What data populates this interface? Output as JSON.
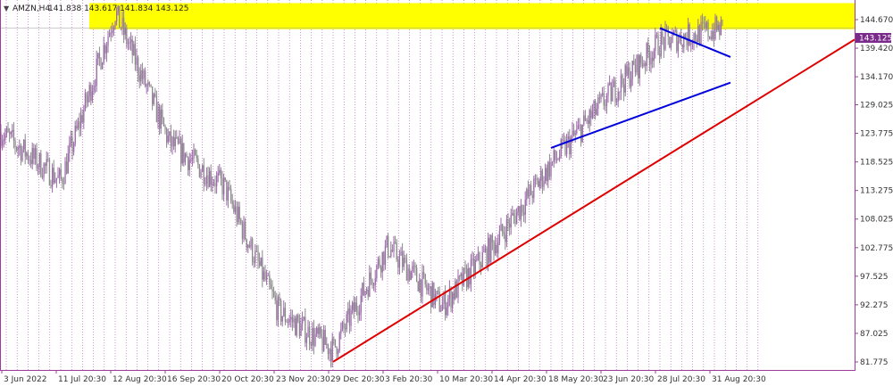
{
  "header": {
    "symbol": "AMZN,H4",
    "ohlc": "141.838 143.617 141.834 143.125"
  },
  "current_price": {
    "label": "143.125",
    "value": 143.125
  },
  "colors": {
    "candle_up": "#9b6aa8",
    "candle_down": "#8a8a8a",
    "grid": "#b04fb0",
    "axis": "#9c3d9c",
    "zone": "#ffff00",
    "support": "#e00000",
    "triangle": "#0000dd",
    "price_box": "#7a2a8a"
  },
  "chart_data": {
    "type": "candlestick",
    "title": "",
    "xlabel": "",
    "ylabel": "",
    "ylim": [
      80.0,
      149.0
    ],
    "y_ticks": [
      "144.670",
      "139.420",
      "134.170",
      "129.025",
      "123.775",
      "118.525",
      "113.275",
      "108.025",
      "102.775",
      "97.525",
      "92.275",
      "87.025",
      "81.775"
    ],
    "y_tick_values": [
      144.67,
      139.42,
      134.17,
      129.025,
      123.775,
      118.525,
      113.275,
      108.025,
      102.775,
      97.525,
      92.275,
      87.025,
      81.775
    ],
    "x_labels": [
      "3 Jun 2022",
      "11 Jul 20:30",
      "12 Aug 20:30",
      "16 Sep 20:30",
      "20 Oct 20:30",
      "23 Nov 20:30",
      "29 Dec 20:30",
      "3 Feb 20:30",
      "10 Mar 20:30",
      "14 Apr 20:30",
      "18 May 20:30",
      "23 Jun 20:30",
      "28 Jul 20:30",
      "31 Aug 20:30"
    ],
    "price_path": [
      [
        "3 Jun 2022",
        124.0
      ],
      [
        "11 Jul 20:30",
        115.0
      ],
      [
        "12 Aug 20:30",
        146.0
      ],
      [
        "16 Sep 20:30",
        122.0
      ],
      [
        "20 Oct 20:30",
        114.0
      ],
      [
        "23 Nov 20:30",
        91.0
      ],
      [
        "29 Dec 20:30",
        84.0
      ],
      [
        "3 Feb 20:30",
        103.0
      ],
      [
        "10 Mar 20:30",
        92.0
      ],
      [
        "14 Apr 20:30",
        104.0
      ],
      [
        "18 May 20:30",
        118.0
      ],
      [
        "23 Jun 20:30",
        130.0
      ],
      [
        "28 Jul 20:30",
        140.5
      ],
      [
        "31 Aug 20:30",
        143.125
      ]
    ],
    "resistance_zone": [
      142.9,
      147.7
    ],
    "support_line": {
      "start": [
        "29 Dec 20:30",
        81.8
      ],
      "end": [
        "31 Aug 20:30",
        141.0
      ]
    },
    "triangle_upper": {
      "start": [
        "28 Jul 20:30",
        143.1
      ],
      "end": [
        "31 Aug 20:30",
        137.8
      ]
    },
    "triangle_lower": {
      "start": [
        "18 May 20:30",
        121.1
      ],
      "end": [
        "31 Aug 20:30",
        133.1
      ]
    },
    "grid": true
  }
}
